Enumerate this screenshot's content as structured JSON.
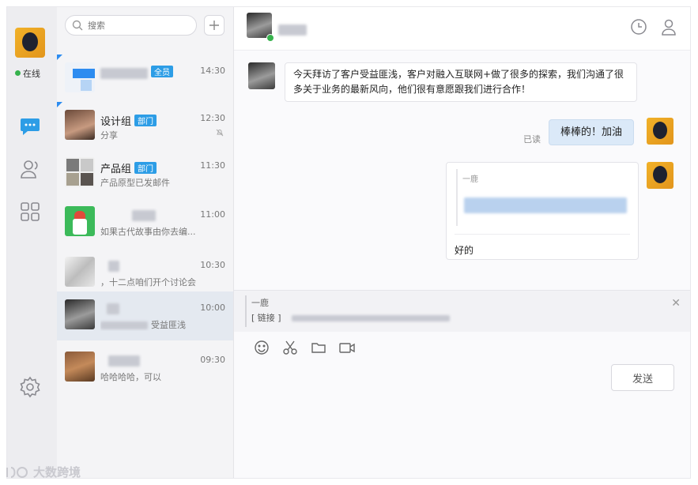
{
  "rail": {
    "status": "在线",
    "nav": [
      "chat-icon",
      "contacts-icon",
      "apps-icon",
      "settings-icon"
    ]
  },
  "search": {
    "placeholder": "搜索"
  },
  "conversations": [
    {
      "name": "",
      "tag": "全员",
      "time": "14:30",
      "preview": ""
    },
    {
      "name": "设计组",
      "tag": "部门",
      "time": "12:30",
      "preview": "分享"
    },
    {
      "name": "产品组",
      "tag": "部门",
      "time": "11:30",
      "preview": "产品原型已发邮件"
    },
    {
      "name": "",
      "tag": "",
      "time": "11:00",
      "preview": "如果古代故事由你去编..."
    },
    {
      "name": "",
      "tag": "",
      "time": "10:30",
      "preview": "，十二点咱们开个讨论会"
    },
    {
      "name": "",
      "tag": "",
      "time": "10:00",
      "preview": "受益匪浅"
    },
    {
      "name": "",
      "tag": "",
      "time": "09:30",
      "preview": "哈哈哈哈，可以"
    }
  ],
  "chat": {
    "messages": [
      {
        "from": "other",
        "text": "今天拜访了客户受益匪浅，客户对融入互联网+做了很多的探索，我们沟通了很多关于业务的最新风向，他们很有意愿跟我们进行合作！"
      },
      {
        "from": "me",
        "text": "棒棒的！加油",
        "status": "已读"
      },
      {
        "from": "me",
        "quote_author": "一鹿",
        "reply": "好的"
      }
    ],
    "quote_bar": {
      "author": "一鹿",
      "link": "[ 链接 ]"
    },
    "send_label": "发送"
  },
  "watermark": "大数跨境",
  "colors": {
    "accent": "#2d9de6",
    "online": "#37b24d",
    "bubble_self": "#dbe9f8"
  }
}
